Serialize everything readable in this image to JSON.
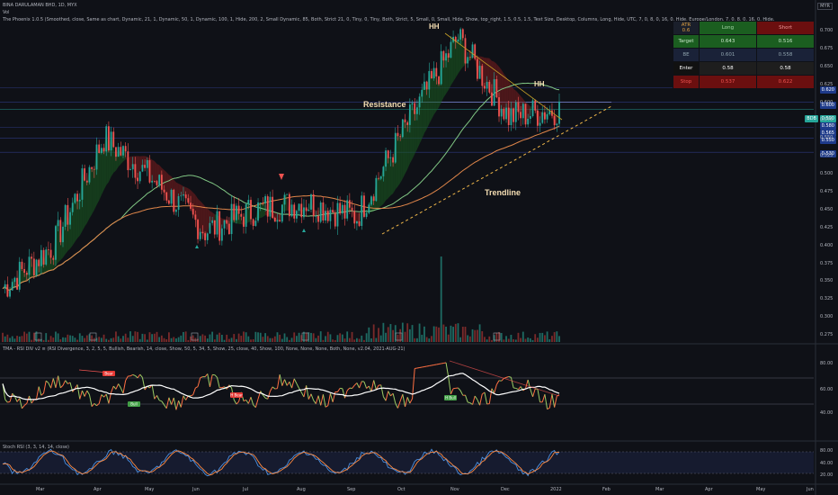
{
  "header": {
    "line1": "BINA DARULAMAN BHD, 1D, MYX",
    "line2": "Vol",
    "line3": "The Phoenix 1.0.5 (Smoothed, close, Same as chart, Dynamic, 21, 1, Dynamic, 50, 1, Dynamic, 100, 1, Hide, 200, 2, Small Dynamic, 85, Both, Strict 21, 0, Tiny, 0, Tiny, Both, Strict, 5, Small, 0, Small, Hide, Show, top_right, 1.5, 0.5, 1.5, Text Size, Desktop, Columns, Long, Hide, UTC, 7, 0, 8, 0, 16, 0, Hide, Europe/London, 7, 0, 8, 0, 16, 0, Hide, v1.04, 2021-SEP-18)",
    "currency": "MYR"
  },
  "table": {
    "atr_label": "ATR",
    "atr_value": "0.6",
    "col_long": "Long",
    "col_short": "Short",
    "rows": [
      {
        "label": "Target",
        "long": "0.643",
        "short": "0.516"
      },
      {
        "label": "BE",
        "long": "0.601",
        "short": "0.558"
      },
      {
        "label": "Enter",
        "long": "0.58",
        "short": "0.58"
      },
      {
        "label": "Stop",
        "long": "0.537",
        "short": "0.622"
      }
    ]
  },
  "annotations": {
    "hh_left": "HH",
    "hh_right": "HH",
    "resistance": "Resistance",
    "trendline": "Trendline"
  },
  "price_tags": [
    {
      "value": "0.620",
      "color": "#1e3a8a"
    },
    {
      "value": "0.600",
      "color": "#1e3a8a"
    },
    {
      "value": "0.590",
      "color": "#26a69a"
    },
    {
      "value": "0.580",
      "color": "#1e3a8a"
    },
    {
      "value": "0.565",
      "color": "#1e3a8a"
    },
    {
      "value": "0.550",
      "color": "#1e3a8a"
    },
    {
      "value": "0.530",
      "color": "#1e3a8a"
    }
  ],
  "last_price_tag": "BDB",
  "panel2": {
    "title": "TMA - RSI DIV v2 ≡ (RSI Divergence, 3, 2, 5, 5, Bullish, Bearish, 14, close, Show, 50, 5, 34, 5, Show, 25, close, 40, Show, 100, None, None, None, Both, None, v2.04, 2021-AUG-21)",
    "labels": {
      "bear": "Bear",
      "bull": "Bull",
      "hbear": "H Bear",
      "hbull": "H Bull"
    },
    "yticks": [
      "80.00",
      "60.00",
      "40.00"
    ]
  },
  "panel3": {
    "title": "Stoch RSI (3, 3, 14, 14, close)",
    "yticks": [
      "80.00",
      "40.00",
      "20.00"
    ]
  },
  "chart_data": {
    "type": "candlestick",
    "title": "BINA DARULAMAN BHD, 1D, MYX",
    "y_axis_ticks": [
      "0.700",
      "0.675",
      "0.650",
      "0.625",
      "0.600",
      "0.575",
      "0.550",
      "0.525",
      "0.500",
      "0.475",
      "0.450",
      "0.425",
      "0.400",
      "0.375",
      "0.350",
      "0.325",
      "0.300",
      "0.275"
    ],
    "ylim": [
      0.265,
      0.705
    ],
    "x_axis_ticks": [
      "Mar",
      "Apr",
      "May",
      "Jun",
      "Jul",
      "Aug",
      "Sep",
      "Oct",
      "Nov",
      "Dec",
      "2022",
      "Feb",
      "Mar",
      "Apr",
      "May",
      "Jun"
    ],
    "close_points": [
      {
        "month": "Feb",
        "close": 0.34
      },
      {
        "month": "Mar",
        "close": 0.4
      },
      {
        "month": "Apr",
        "close": 0.55
      },
      {
        "month": "May",
        "close": 0.49
      },
      {
        "month": "Jun",
        "close": 0.42
      },
      {
        "month": "Jul",
        "close": 0.45
      },
      {
        "month": "Aug",
        "close": 0.46
      },
      {
        "month": "Sep",
        "close": 0.44
      },
      {
        "month": "Oct",
        "close": 0.57
      },
      {
        "month": "Nov",
        "close": 0.69
      },
      {
        "month": "Dec",
        "close": 0.58
      },
      {
        "month": "2022",
        "close": 0.59
      }
    ],
    "colors": {
      "up": "#26a69a",
      "down": "#ef5350",
      "ma_fast": "#81c784",
      "ma_slow": "#e57373"
    }
  }
}
